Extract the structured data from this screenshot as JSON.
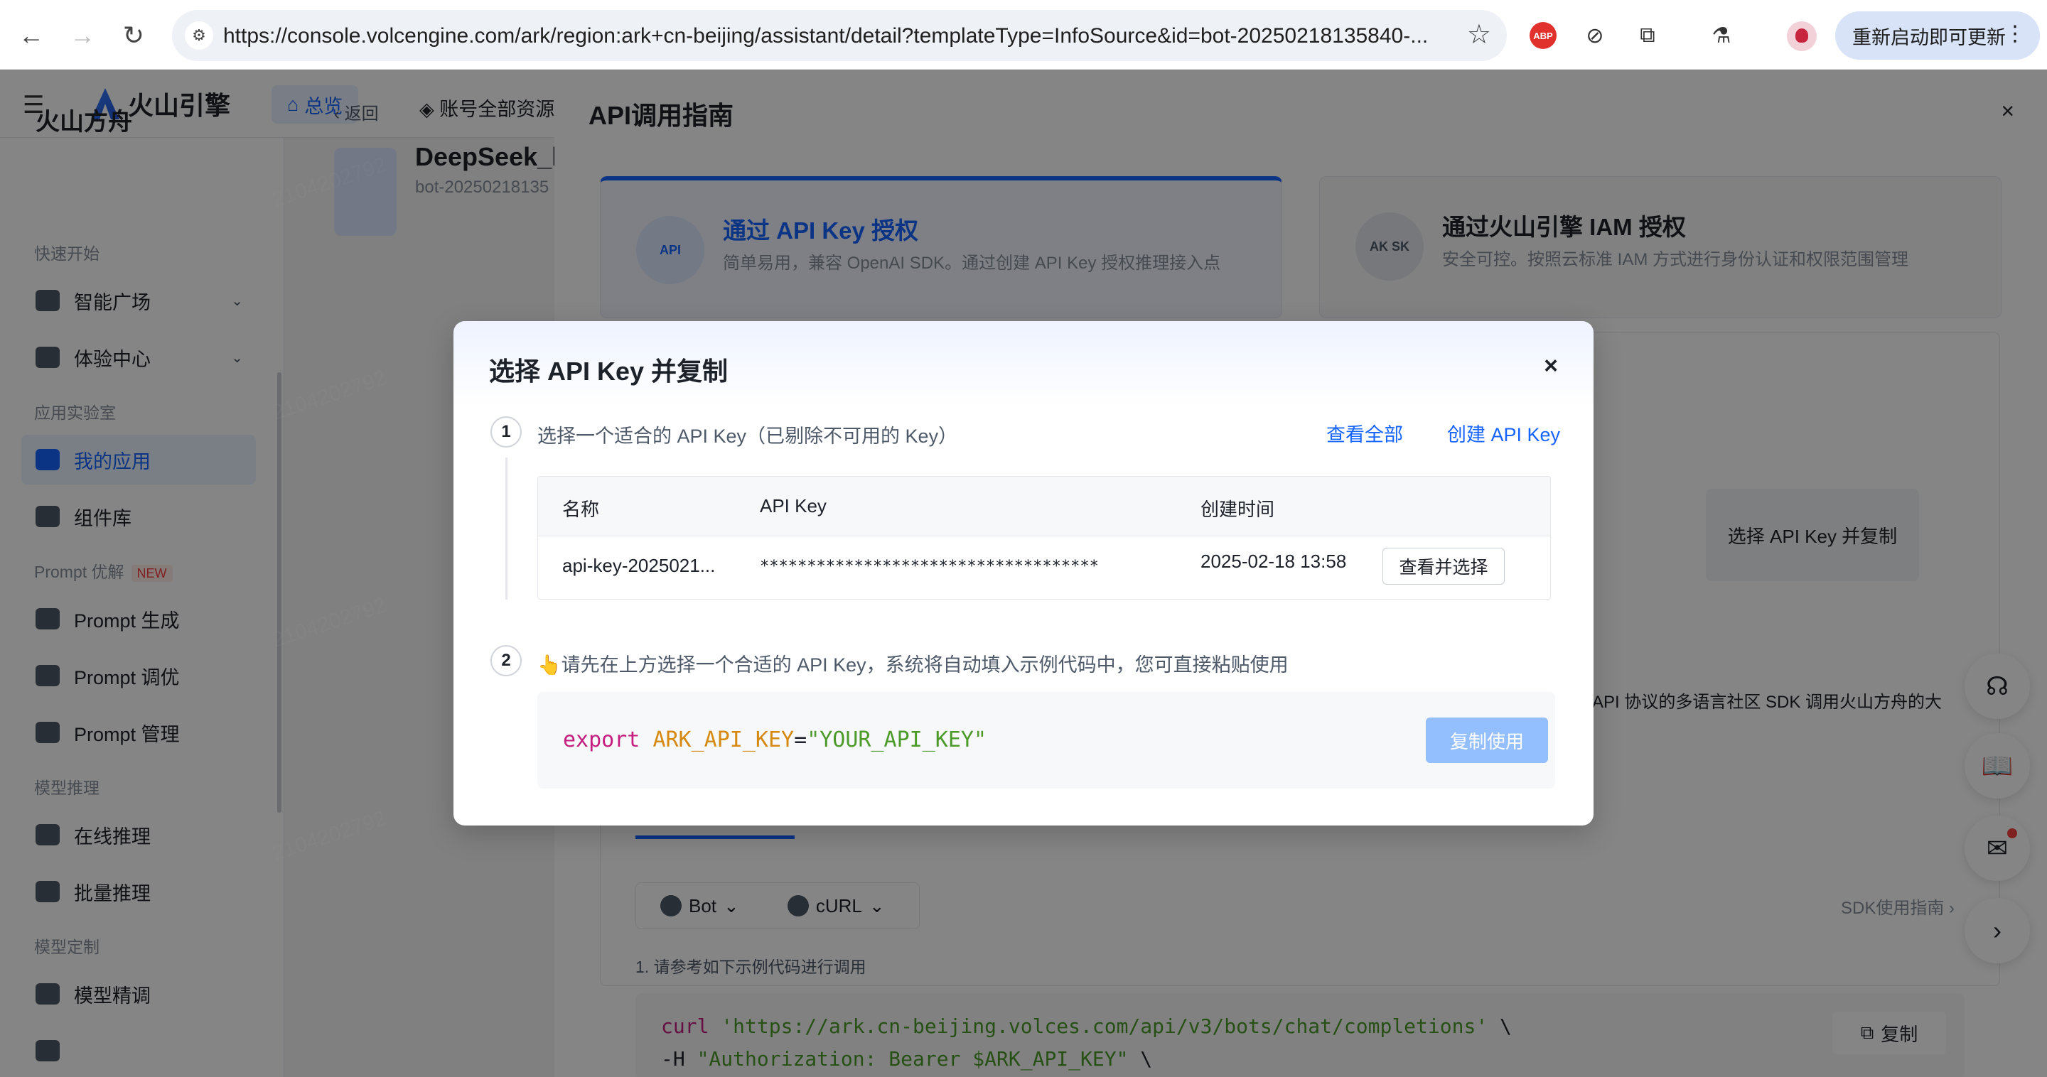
{
  "browser": {
    "url": "https://console.volcengine.com/ark/region:ark+cn-beijing/assistant/detail?templateType=InfoSource&id=bot-20250218135840-...",
    "update_label": "重新启动即可更新",
    "abp_label": "ABP"
  },
  "console": {
    "brand": "火山引擎",
    "home_tab": "总览",
    "account_tab": "账号全部资源",
    "sidebar": {
      "title": "火山方舟",
      "groups": {
        "quick_start": "快速开始",
        "app_lab": "应用实验室",
        "prompt_opt": "Prompt 优解",
        "model_infer": "模型推理",
        "model_custom": "模型定制"
      },
      "items": [
        {
          "label": "智能广场"
        },
        {
          "label": "体验中心"
        },
        {
          "label": "我的应用"
        },
        {
          "label": "组件库"
        },
        {
          "label": "Prompt 生成"
        },
        {
          "label": "Prompt 调优"
        },
        {
          "label": "Prompt 管理"
        },
        {
          "label": "在线推理"
        },
        {
          "label": "批量推理"
        },
        {
          "label": "模型精调"
        }
      ],
      "new_badge": "NEW"
    },
    "back": "返回",
    "bot_name": "DeepSeek_l",
    "bot_id": "bot-20250218135"
  },
  "drawer": {
    "title": "API调用指南",
    "close": "×",
    "auth_api_key": {
      "title": "通过 API Key 授权",
      "desc": "简单易用，兼容 OpenAI SDK。通过创建 API Key 授权推理接入点",
      "icon_text": "API"
    },
    "auth_iam": {
      "title": "通过火山引擎 IAM 授权",
      "desc": "安全可控。按照云标准 IAM 方式进行身份认证和权限范围管理",
      "icon_text": "AK SK"
    },
    "select_copy": "选择 API Key 并复制",
    "sdk_desc": "API 协议的多语言社区 SDK 调用火山方舟的大",
    "sub_tabs": [
      "Bot",
      "cURL"
    ],
    "sdk_guide": "SDK使用指南 ›",
    "step_hint": "1. 请参考如下示例代码进行调用",
    "code_lines": [
      {
        "prefix": "curl ",
        "string": "'https://ark.cn-beijing.volces.com/api/v3/bots/chat/completions'",
        "suffix": " \\"
      },
      {
        "prefix": "-H ",
        "string": "\"Authorization: Bearer $ARK_API_KEY\"",
        "suffix": " \\"
      }
    ],
    "copy": "复制"
  },
  "modal": {
    "title": "选择 API Key 并复制",
    "close": "×",
    "step1": {
      "num": "1",
      "text": "选择一个适合的 API Key（已剔除不可用的 Key）",
      "view_all": "查看全部",
      "create": "创建 API Key"
    },
    "table": {
      "headers": [
        "名称",
        "API Key",
        "创建时间"
      ],
      "rows": [
        {
          "name": "api-key-2025021...",
          "key": "************************************",
          "created": "2025-02-18 13:58",
          "action": "查看并选择"
        }
      ]
    },
    "step2": {
      "num": "2",
      "text": "👆请先在上方选择一个合适的 API Key，系统将自动填入示例代码中，您可直接粘贴使用"
    },
    "code": {
      "keyword": "export",
      "var": "ARK_API_KEY",
      "eq": "=",
      "value": "\"YOUR_API_KEY\""
    },
    "copy_use": "复制使用"
  },
  "watermark": "2104202792"
}
